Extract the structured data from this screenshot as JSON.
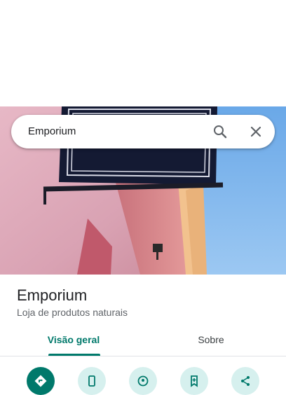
{
  "search": {
    "query": "Emporium"
  },
  "icons": {
    "search": "search-icon",
    "close": "close-icon",
    "directions": "directions-icon",
    "phone": "phone-icon",
    "nearby": "nearby-icon",
    "save": "save-icon",
    "share": "share-icon"
  },
  "place": {
    "name": "Emporium",
    "category": "Loja de produtos naturais"
  },
  "tabs": [
    {
      "label": "Visão geral",
      "selected": true
    },
    {
      "label": "Sobre",
      "selected": false
    }
  ],
  "colors": {
    "accent": "#00796b",
    "accent_light": "#d6f0ee",
    "text_primary": "#202124",
    "text_secondary": "#5f6368"
  }
}
